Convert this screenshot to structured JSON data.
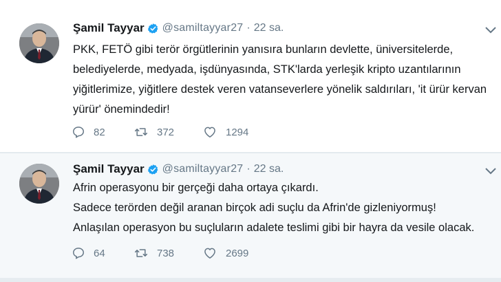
{
  "tweets": [
    {
      "author": "Şamil Tayyar",
      "handle": "@samiltayyar27",
      "separator": "·",
      "time": "22 sa.",
      "lines": [
        "PKK, FETÖ gibi terör örgütlerinin yanısıra bunların devlette, üniversitelerde,",
        "belediyelerde, medyada, işdünyasında, STK'larda  yerleşik kripto uzantılarının",
        "yiğitlerimize, yiğitlere destek veren vatanseverlere yönelik saldırıları, 'it ürür kervan",
        "yürür' önemindedir!"
      ],
      "replies": "82",
      "retweets": "372",
      "likes": "1294"
    },
    {
      "author": "Şamil Tayyar",
      "handle": "@samiltayyar27",
      "separator": "·",
      "time": "22 sa.",
      "lines": [
        "Afrin operasyonu bir gerçeği daha ortaya çıkardı.",
        "Sadece terörden değil aranan birçok adi suçlu da Afrin'de gizleniyormuş!",
        "Anlaşılan operasyon bu suçluların adalete teslimi gibi bir hayra da vesile olacak."
      ],
      "replies": "64",
      "retweets": "738",
      "likes": "2699"
    }
  ],
  "colors": {
    "text": "#14171a",
    "secondary": "#657786",
    "verified": "#1da1f2",
    "background": "#e6ecf0"
  },
  "icons": {
    "reply": "reply-icon",
    "retweet": "retweet-icon",
    "like": "heart-icon",
    "verified": "verified-badge-icon",
    "menu": "chevron-down-icon"
  }
}
